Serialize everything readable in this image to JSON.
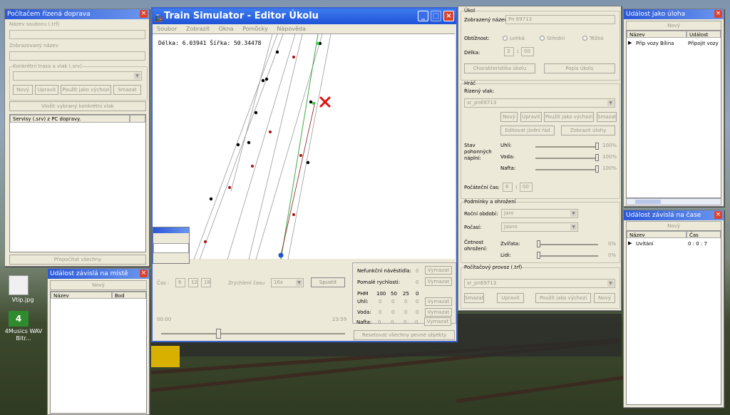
{
  "desktop": {
    "icons": [
      {
        "label": "Vtip.jpg"
      },
      {
        "label": "4Musics WAV Bitr..."
      }
    ]
  },
  "left_panel": {
    "title": "Počítačem řízená doprava",
    "file_name_label": "Název souboru (.trf)",
    "friendly_name_label": "Zobrazovaný název",
    "route_group_label": "Konkrétní trasa a vlak (.srv)",
    "btn_new": "Nový",
    "btn_edit": "Upravit",
    "btn_use_as_default": "Použít jako výchozí",
    "btn_delete": "Smazat",
    "btn_insert_train": "Vložit vybraný konkrétní vlak",
    "list_header": "Servisy (.srv) z PC dopravy.",
    "btn_recalc": "Přepočítat všechny"
  },
  "place_event_panel": {
    "title": "Událost závislá na místě",
    "btn_new": "Nový",
    "col_name": "Název",
    "col_point": "Bod"
  },
  "main_window": {
    "title": "Train Simulator - Editor Úkolu",
    "menu": [
      "Soubor",
      "Zobrazit",
      "Okna",
      "Pomůcky",
      "Nápověda"
    ],
    "coords_text": "Délka: 6.03941  Šířka: 50.34478",
    "time_label": "Čas :",
    "time_h": "6",
    "time_m": "12",
    "time_s": "18",
    "speedup_label": "Zrychlení času",
    "speedup_value": "16x",
    "run_button": "Spustit",
    "timeline_start": "00:00",
    "timeline_end": "23:59",
    "timeline_position": 0.31,
    "signals_label": "Nefunkční návěstidla:",
    "signals_value": "0",
    "slow_label": "Pomalé rychlosti:",
    "slow_value": "0",
    "clear_btn": "Vymazat",
    "fuel_header": [
      "PHM",
      "100",
      "50",
      "25",
      "0"
    ],
    "fuel_rows": [
      {
        "name": "Uhlí:",
        "vals": [
          "0",
          "0",
          "0",
          "0"
        ]
      },
      {
        "name": "Voda:",
        "vals": [
          "0",
          "0",
          "0",
          "0"
        ]
      },
      {
        "name": "Nafta:",
        "vals": [
          "0",
          "0",
          "0",
          "0"
        ]
      }
    ],
    "reset_btn": "Resetovat všechny pevné objekty"
  },
  "task_panel": {
    "group_title": "Úkol",
    "display_name_label": "Zobrazený název:",
    "display_name_value": "Pn 69713",
    "difficulty_label": "Obtížnost:",
    "difficulty_options": [
      "Lehká",
      "Střední",
      "Těžká"
    ],
    "length_label": "Délka:",
    "length_h": "3",
    "length_m": "00",
    "btn_task_props": "Charakteristika úkolu",
    "btn_task_desc": "Popis úkolu",
    "player_group": "Hráč",
    "driven_train_label": "Řízený vlak:",
    "driven_train_value": "sr_pn69713",
    "btn_new": "Nový",
    "btn_edit": "Upravit",
    "btn_use_default": "Použít jako výchozí",
    "btn_delete": "Smazat",
    "btn_edit_timetable": "Editovat jízdní řád",
    "btn_show_tasks": "Zobrazit úlohy",
    "fuel_state_label": "Stav pohonných náplní:",
    "fuel_items": [
      {
        "name": "Uhlí:",
        "pct": "100%",
        "level": 1.0
      },
      {
        "name": "Voda:",
        "pct": "100%",
        "level": 1.0
      },
      {
        "name": "Nafta:",
        "pct": "100%",
        "level": 1.0
      }
    ],
    "start_time_label": "Počáteční čas:",
    "start_h": "6",
    "start_m": "00",
    "conditions_group": "Podmínky a ohrožení",
    "season_label": "Roční období:",
    "season_value": "Jaro",
    "weather_label": "Počasí:",
    "weather_value": "Jasno",
    "danger_label": "Četnost ohrožení:",
    "animals_label": "Zvířata:",
    "animals_pct": "0%",
    "people_label": "Lidi:",
    "people_pct": "0%",
    "traffic_group": "Počítačový provoz (.trf)",
    "traffic_value": "sr_pn69713",
    "btn_traffic_delete": "Smazat",
    "btn_traffic_edit": "Upravit",
    "btn_traffic_default": "Použít jako výchozí",
    "btn_traffic_new": "Nový"
  },
  "task_event_panel": {
    "title": "Událost jako úloha",
    "btn_new": "Nový",
    "col_name": "Název",
    "col_event": "Událost",
    "rows": [
      {
        "name": "Příp vozy Bílina",
        "event": "Připojit vozy"
      }
    ]
  },
  "time_event_panel": {
    "title": "Událost závislá na čase",
    "btn_new": "Nový",
    "col_name": "Název",
    "col_time": "Čas",
    "rows": [
      {
        "name": "Uvítání",
        "time": "0 : 0 : 7"
      }
    ]
  }
}
